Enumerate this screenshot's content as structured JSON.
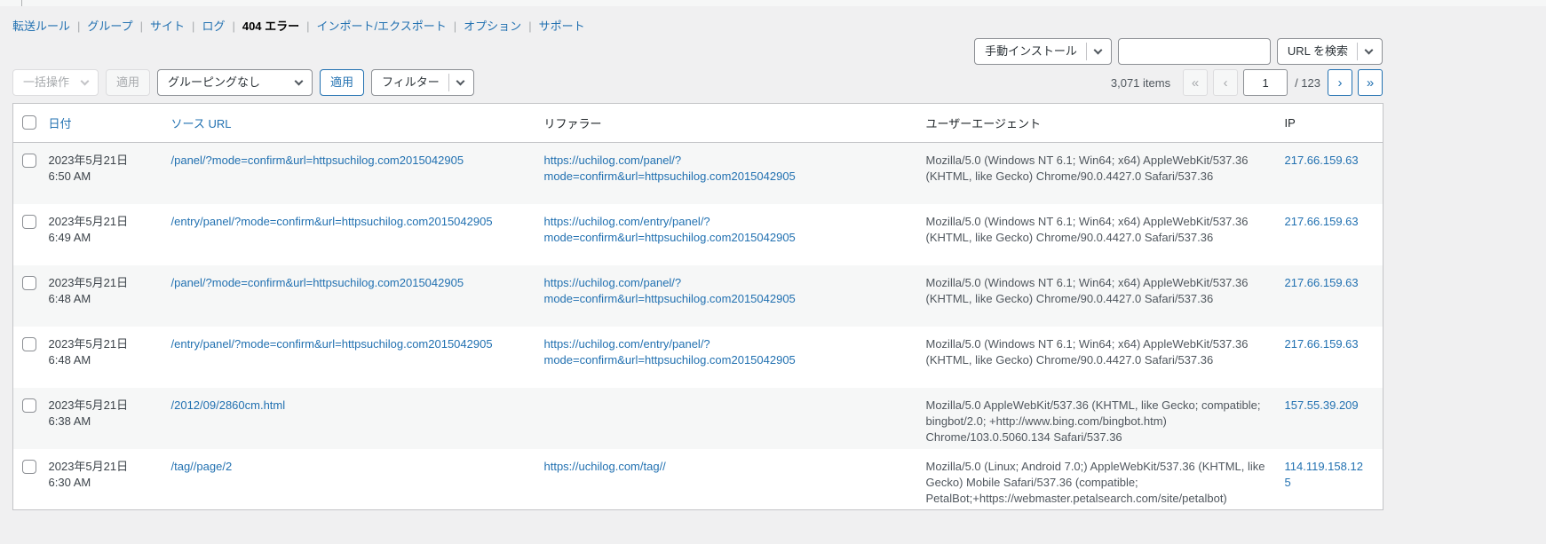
{
  "nav": {
    "separator": "|",
    "items": [
      {
        "label": "転送ルール",
        "current": false
      },
      {
        "label": "グループ",
        "current": false
      },
      {
        "label": "サイト",
        "current": false
      },
      {
        "label": "ログ",
        "current": false
      },
      {
        "label": "404 エラー",
        "current": true
      },
      {
        "label": "インポート/エクスポート",
        "current": false
      },
      {
        "label": "オプション",
        "current": false
      },
      {
        "label": "サポート",
        "current": false
      }
    ]
  },
  "header_controls": {
    "install_label": "手動インストール",
    "search_value": "",
    "search_button_label": "URL を検索"
  },
  "toolbar": {
    "bulk_actions_label": "一括操作",
    "apply_bulk_label": "適用",
    "grouping_label": "グルーピングなし",
    "apply_label": "適用",
    "filter_label": "フィルター"
  },
  "pagination": {
    "items_count": "3,071 items",
    "first_label": "«",
    "prev_label": "‹",
    "current_page": "1",
    "total_pages_label": "/ 123",
    "next_label": "›",
    "last_label": "»"
  },
  "table": {
    "columns": [
      {
        "id": "date",
        "label": "日付",
        "sortable": true
      },
      {
        "id": "source",
        "label": "ソース URL",
        "sortable": true
      },
      {
        "id": "referrer",
        "label": "リファラー",
        "sortable": false
      },
      {
        "id": "ua",
        "label": "ユーザーエージェント",
        "sortable": false
      },
      {
        "id": "ip",
        "label": "IP",
        "sortable": false
      }
    ],
    "rows": [
      {
        "date": "2023年5月21日",
        "time": "6:50 AM",
        "source": "/panel/?mode=confirm&url=httpsuchilog.com2015042905",
        "referrer": "https://uchilog.com/panel/?mode=confirm&url=httpsuchilog.com2015042905",
        "user_agent": "Mozilla/5.0 (Windows NT 6.1; Win64; x64) AppleWebKit/537.36 (KHTML, like Gecko) Chrome/90.0.4427.0 Safari/537.36",
        "ip": "217.66.159.63"
      },
      {
        "date": "2023年5月21日",
        "time": "6:49 AM",
        "source": "/entry/panel/?mode=confirm&url=httpsuchilog.com2015042905",
        "referrer": "https://uchilog.com/entry/panel/?mode=confirm&url=httpsuchilog.com2015042905",
        "user_agent": "Mozilla/5.0 (Windows NT 6.1; Win64; x64) AppleWebKit/537.36 (KHTML, like Gecko) Chrome/90.0.4427.0 Safari/537.36",
        "ip": "217.66.159.63"
      },
      {
        "date": "2023年5月21日",
        "time": "6:48 AM",
        "source": "/panel/?mode=confirm&url=httpsuchilog.com2015042905",
        "referrer": "https://uchilog.com/panel/?mode=confirm&url=httpsuchilog.com2015042905",
        "user_agent": "Mozilla/5.0 (Windows NT 6.1; Win64; x64) AppleWebKit/537.36 (KHTML, like Gecko) Chrome/90.0.4427.0 Safari/537.36",
        "ip": "217.66.159.63"
      },
      {
        "date": "2023年5月21日",
        "time": "6:48 AM",
        "source": "/entry/panel/?mode=confirm&url=httpsuchilog.com2015042905",
        "referrer": "https://uchilog.com/entry/panel/?mode=confirm&url=httpsuchilog.com2015042905",
        "user_agent": "Mozilla/5.0 (Windows NT 6.1; Win64; x64) AppleWebKit/537.36 (KHTML, like Gecko) Chrome/90.0.4427.0 Safari/537.36",
        "ip": "217.66.159.63"
      },
      {
        "date": "2023年5月21日",
        "time": "6:38 AM",
        "source": "/2012/09/2860cm.html",
        "referrer": "",
        "user_agent": "Mozilla/5.0 AppleWebKit/537.36 (KHTML, like Gecko; compatible; bingbot/2.0; +http://www.bing.com/bingbot.htm) Chrome/103.0.5060.134 Safari/537.36",
        "ip": "157.55.39.209"
      },
      {
        "date": "2023年5月21日",
        "time": "6:30 AM",
        "source": "/tag//page/2",
        "referrer": "https://uchilog.com/tag//",
        "user_agent": "Mozilla/5.0 (Linux; Android 7.0;) AppleWebKit/537.36 (KHTML, like Gecko) Mobile Safari/537.36 (compatible; PetalBot;+https://webmaster.petalsearch.com/site/petalbot)",
        "ip": "114.119.158.125"
      }
    ]
  },
  "colors": {
    "accent": "#2271b1",
    "page_background": "#f0f0f1",
    "stripe": "#f6f7f7",
    "table_border": "#c3c4c7"
  }
}
